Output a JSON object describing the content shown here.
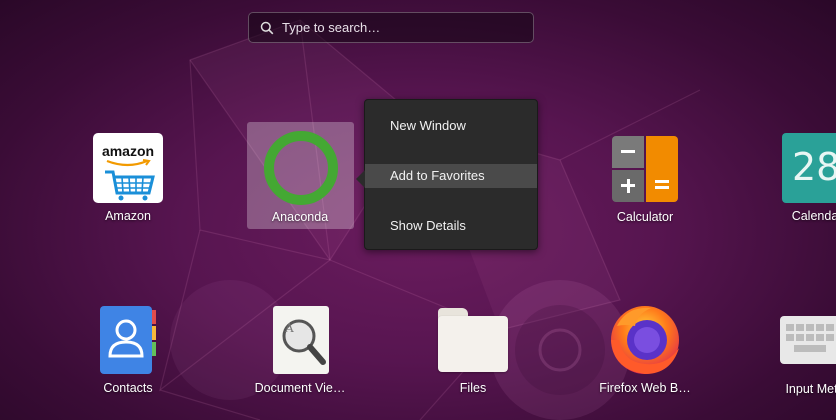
{
  "search": {
    "placeholder": "Type to search…"
  },
  "apps_row1": [
    {
      "label": "Amazon",
      "icon": "amazon-icon",
      "icon_text": "amazon"
    },
    {
      "label": "Anaconda",
      "icon": "anaconda-icon"
    },
    {
      "label": "Calculator",
      "icon": "calculator-icon"
    },
    {
      "label": "Calenda",
      "icon": "calendar-icon",
      "icon_text": "28"
    }
  ],
  "apps_row2": [
    {
      "label": "Contacts",
      "icon": "contacts-icon"
    },
    {
      "label": "Document Vie…",
      "icon": "document-viewer-icon"
    },
    {
      "label": "Files",
      "icon": "files-icon"
    },
    {
      "label": "Firefox Web B…",
      "icon": "firefox-icon"
    },
    {
      "label": "Input Meth",
      "icon": "keyboard-icon"
    }
  ],
  "context_menu": {
    "items": [
      "New Window",
      "Add to Favorites",
      "Show Details"
    ],
    "highlighted": "Add to Favorites"
  },
  "colors": {
    "accent_orange": "#f28b00",
    "anaconda_green": "#44a833",
    "bg_purple": "#571550"
  }
}
